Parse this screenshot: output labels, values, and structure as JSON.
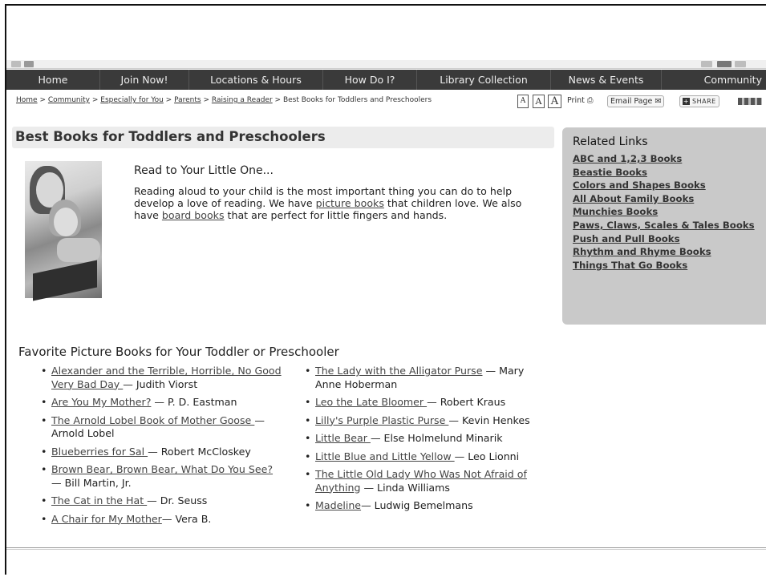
{
  "nav": {
    "items": [
      "Home",
      "Join Now!",
      "Locations & Hours",
      "How Do I?",
      "Library Collection",
      "News & Events",
      "Community"
    ]
  },
  "breadcrumb": {
    "links": [
      "Home",
      "Community",
      "Especially for You",
      "Parents",
      "Raising a Reader"
    ],
    "current": "Best Books for Toddlers and Preschoolers",
    "separator": ">"
  },
  "toolbar": {
    "font_small": "A",
    "font_medium": "A",
    "font_large": "A",
    "print_label": "Print",
    "email_label": "Email Page",
    "share_label": "SHARE"
  },
  "page": {
    "title": "Best Books for Toddlers and Preschoolers"
  },
  "intro": {
    "heading": "Read to Your Little One...",
    "text_1": "Reading aloud to your child is the most important thing you can do to help develop a love of reading.  We have ",
    "link_picture": "picture books",
    "text_2": " that children love.  We also have ",
    "link_board": "board books",
    "text_3": " that are perfect for little fingers and hands."
  },
  "related": {
    "heading": "Related Links",
    "links": [
      "ABC and 1,2,3 Books",
      "Beastie Books",
      "Colors and Shapes Books",
      "All About Family Books",
      "Munchies Books",
      "Paws, Claws, Scales & Tales Books",
      "Push and Pull Books",
      "Rhythm and Rhyme Books",
      "Things That Go Books"
    ]
  },
  "favorites": {
    "heading": "Favorite Picture Books for Your Toddler or Preschooler",
    "left": [
      {
        "title": "Alexander and the Terrible, Horrible, No Good Very Bad Day ",
        "author": "— Judith Viorst"
      },
      {
        "title": "Are You My Mother?",
        "author": " — P. D. Eastman"
      },
      {
        "title": "The Arnold Lobel Book of Mother Goose ",
        "author": "— Arnold Lobel"
      },
      {
        "title": "Blueberries for Sal ",
        "author": "— Robert McCloskey"
      },
      {
        "title": "Brown Bear, Brown Bear, What Do You See?",
        "author": " — Bill Martin, Jr."
      },
      {
        "title": "The Cat in the Hat ",
        "author": "— Dr. Seuss"
      },
      {
        "title": "A Chair for My Mother",
        "author": "— Vera B."
      }
    ],
    "right": [
      {
        "title": "The Lady with the Alligator Purse",
        "author": " — Mary Anne Hoberman"
      },
      {
        "title": "Leo the Late Bloomer ",
        "author": "— Robert Kraus"
      },
      {
        "title": "Lilly's Purple Plastic Purse ",
        "author": "— Kevin Henkes"
      },
      {
        "title": "Little Bear ",
        "author": "— Else Holmelund Minarik"
      },
      {
        "title": "Little Blue and Little Yellow ",
        "author": "— Leo Lionni"
      },
      {
        "title": "The Little Old Lady Who Was Not Afraid of Anything",
        "author": " — Linda Williams"
      },
      {
        "title": "Madeline",
        "author": "— Ludwig Bemelmans"
      }
    ]
  },
  "icons": {
    "print": "printer-icon",
    "email": "envelope-icon",
    "share": "plus-icon"
  },
  "colors": {
    "nav_bg": "#3a3a3a",
    "sidebar_bg": "#c9c9c9",
    "title_bg": "#ececec"
  }
}
